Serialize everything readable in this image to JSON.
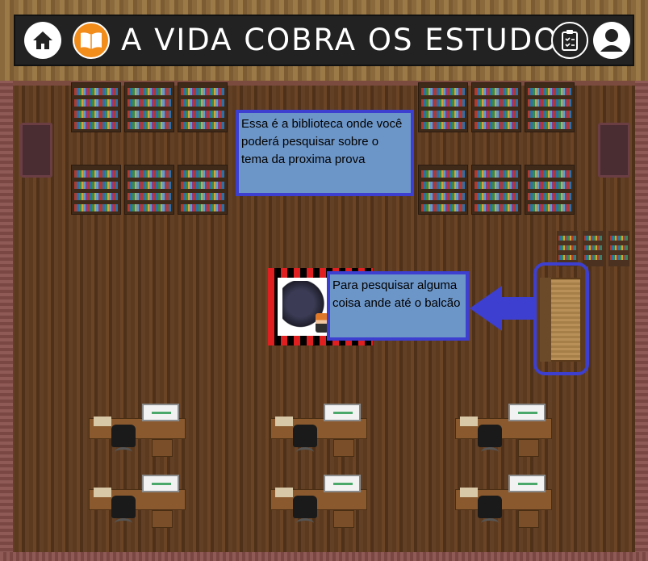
{
  "header": {
    "title": "A VIDA COBRA OS ESTUDOS",
    "home_icon": "home-icon",
    "book_icon": "book-icon",
    "quiz_icon": "clipboard-icon",
    "profile_icon": "user-icon"
  },
  "tooltips": {
    "library_info": "Essa é a biblioteca onde você poderá pesquisar sobre o tema da proxima prova",
    "counter_hint": "Para pesquisar alguma coisa ande até o balcão"
  },
  "colors": {
    "accent_blue": "#3c3fd0",
    "box_fill": "#6d96c8",
    "book_button": "#f28c1a"
  }
}
